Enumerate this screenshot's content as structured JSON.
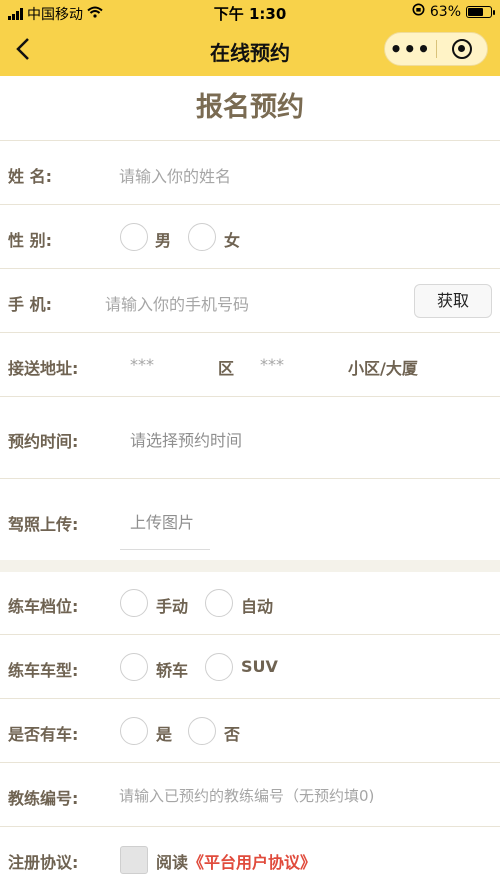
{
  "status": {
    "carrier": "中国移动",
    "time": "下午 1:30",
    "battery": "63%"
  },
  "nav": {
    "title": "在线预约"
  },
  "page": {
    "title": "报名预约"
  },
  "form": {
    "name": {
      "label": "姓 名:",
      "placeholder": "请输入你的姓名"
    },
    "gender": {
      "label": "性 别:",
      "options": [
        "男",
        "女"
      ]
    },
    "phone": {
      "label": "手 机:",
      "placeholder": "请输入你的手机号码",
      "button": "获取"
    },
    "address": {
      "label": "接送地址:",
      "district_value": "***",
      "district_unit": "区",
      "community_value": "***",
      "community_unit": "小区/大厦"
    },
    "time": {
      "label": "预约时间:",
      "placeholder": "请选择预约时间"
    },
    "license": {
      "label": "驾照上传:",
      "button": "上传图片"
    },
    "gear": {
      "label": "练车档位:",
      "options": [
        "手动",
        "自动"
      ]
    },
    "cartype": {
      "label": "练车车型:",
      "options": [
        "轿车",
        "SUV"
      ]
    },
    "hascar": {
      "label": "是否有车:",
      "options": [
        "是",
        "否"
      ]
    },
    "coach": {
      "label": "教练编号:",
      "placeholder": "请输入已预约的教练编号（无预约填0)"
    },
    "agreement": {
      "label": "注册协议:",
      "read": "阅读",
      "link": "《平台用户协议》"
    }
  },
  "icons": {
    "back": "chevron-left-icon",
    "more": "more-dots-icon",
    "close": "target-close-icon"
  },
  "colors": {
    "accent": "#f8d24a",
    "label": "#6f6352",
    "link": "#e04b3c"
  }
}
